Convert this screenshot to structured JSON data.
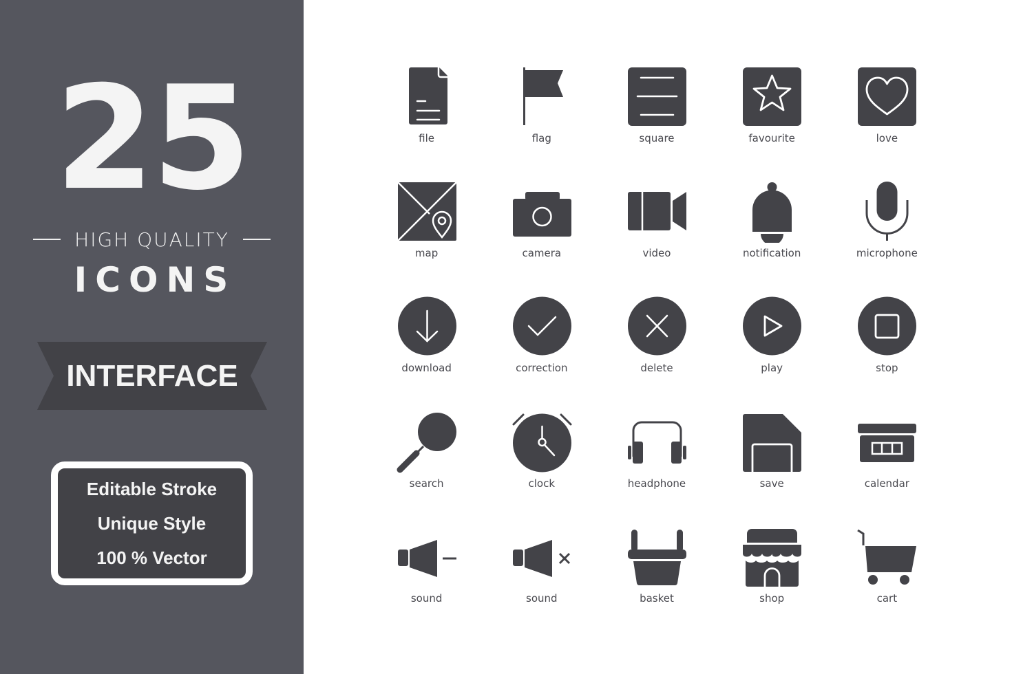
{
  "colors": {
    "panel_bg": "#55565e",
    "ribbon_bg": "#424247",
    "icon_fill": "#434348",
    "text_light": "#f4f4f4",
    "label_text": "#4a4a50"
  },
  "sidebar": {
    "count": "25",
    "subtitle": "HIGH QUALITY",
    "title": "ICONS",
    "category": "INTERFACE",
    "features": [
      "Editable Stroke",
      "Unique Style",
      "100 % Vector"
    ]
  },
  "icons": [
    {
      "label": "file",
      "icon": "file-icon"
    },
    {
      "label": "flag",
      "icon": "flag-icon"
    },
    {
      "label": "square",
      "icon": "square-icon"
    },
    {
      "label": "favourite",
      "icon": "star-icon"
    },
    {
      "label": "love",
      "icon": "heart-icon"
    },
    {
      "label": "map",
      "icon": "map-icon"
    },
    {
      "label": "camera",
      "icon": "camera-icon"
    },
    {
      "label": "video",
      "icon": "video-icon"
    },
    {
      "label": "notification",
      "icon": "bell-icon"
    },
    {
      "label": "microphone",
      "icon": "microphone-icon"
    },
    {
      "label": "download",
      "icon": "download-icon"
    },
    {
      "label": "correction",
      "icon": "check-icon"
    },
    {
      "label": "delete",
      "icon": "delete-icon"
    },
    {
      "label": "play",
      "icon": "play-icon"
    },
    {
      "label": "stop",
      "icon": "stop-icon"
    },
    {
      "label": "search",
      "icon": "search-icon"
    },
    {
      "label": "clock",
      "icon": "alarm-clock-icon"
    },
    {
      "label": "headphone",
      "icon": "headphone-icon"
    },
    {
      "label": "save",
      "icon": "save-icon"
    },
    {
      "label": "calendar",
      "icon": "calendar-icon"
    },
    {
      "label": "sound",
      "icon": "volume-down-icon"
    },
    {
      "label": "sound",
      "icon": "volume-mute-icon"
    },
    {
      "label": "basket",
      "icon": "basket-icon"
    },
    {
      "label": "shop",
      "icon": "shop-icon"
    },
    {
      "label": "cart",
      "icon": "cart-icon"
    }
  ]
}
